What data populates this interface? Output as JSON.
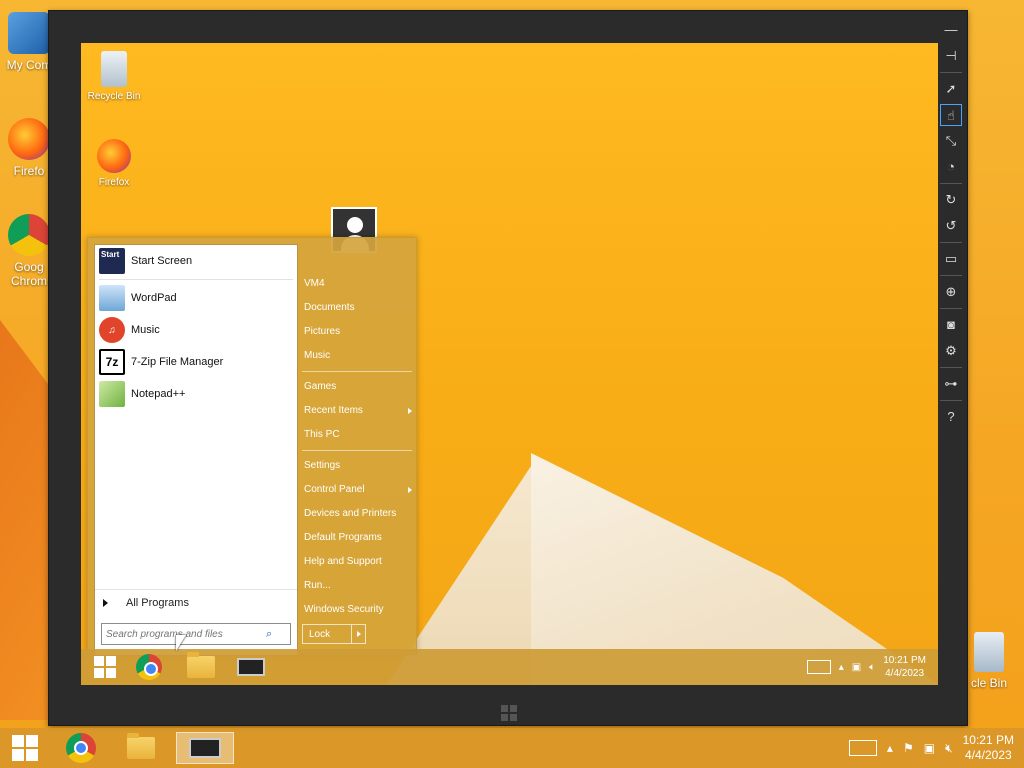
{
  "host_desktop": {
    "icons": [
      {
        "label": "My Com",
        "name": "my-computer"
      },
      {
        "label": "Firefo",
        "name": "firefox"
      },
      {
        "label": "Goog Chrom",
        "name": "google-chrome"
      },
      {
        "label": "cle Bin",
        "name": "recycle-bin"
      }
    ]
  },
  "vm_desktop": {
    "icons": [
      {
        "label": "Recycle Bin"
      },
      {
        "label": "Firefox"
      }
    ]
  },
  "start_menu": {
    "pinned": [
      {
        "label": "Start Screen",
        "icon": "start-screen-icon",
        "icon_text": "Start"
      },
      {
        "label": "WordPad",
        "icon": "wordpad-icon"
      },
      {
        "label": "Music",
        "icon": "music-icon"
      },
      {
        "label": "7-Zip File Manager",
        "icon": "7zip-icon",
        "icon_text": "7z"
      },
      {
        "label": "Notepad++",
        "icon": "notepadpp-icon"
      }
    ],
    "all_programs": "All Programs",
    "search_placeholder": "Search programs and files",
    "right_items": [
      {
        "label": "VM4"
      },
      {
        "label": "Documents"
      },
      {
        "label": "Pictures"
      },
      {
        "label": "Music"
      },
      {
        "label": "Games"
      },
      {
        "label": "Recent Items",
        "submenu": true
      },
      {
        "label": "This PC"
      },
      {
        "label": "Settings"
      },
      {
        "label": "Control Panel",
        "submenu": true
      },
      {
        "label": "Devices and Printers"
      },
      {
        "label": "Default Programs"
      },
      {
        "label": "Help and Support"
      },
      {
        "label": "Run..."
      },
      {
        "label": "Windows Security"
      }
    ],
    "lock_label": "Lock"
  },
  "vm_taskbar": {
    "time": "10:21 PM",
    "date": "4/4/2023"
  },
  "host_taskbar": {
    "time": "10:21 PM",
    "date": "4/4/2023"
  },
  "colors": {
    "accent_orange": "#f5a623",
    "start_panel": "#d4a43c",
    "active_tool": "#4aa3ff"
  }
}
